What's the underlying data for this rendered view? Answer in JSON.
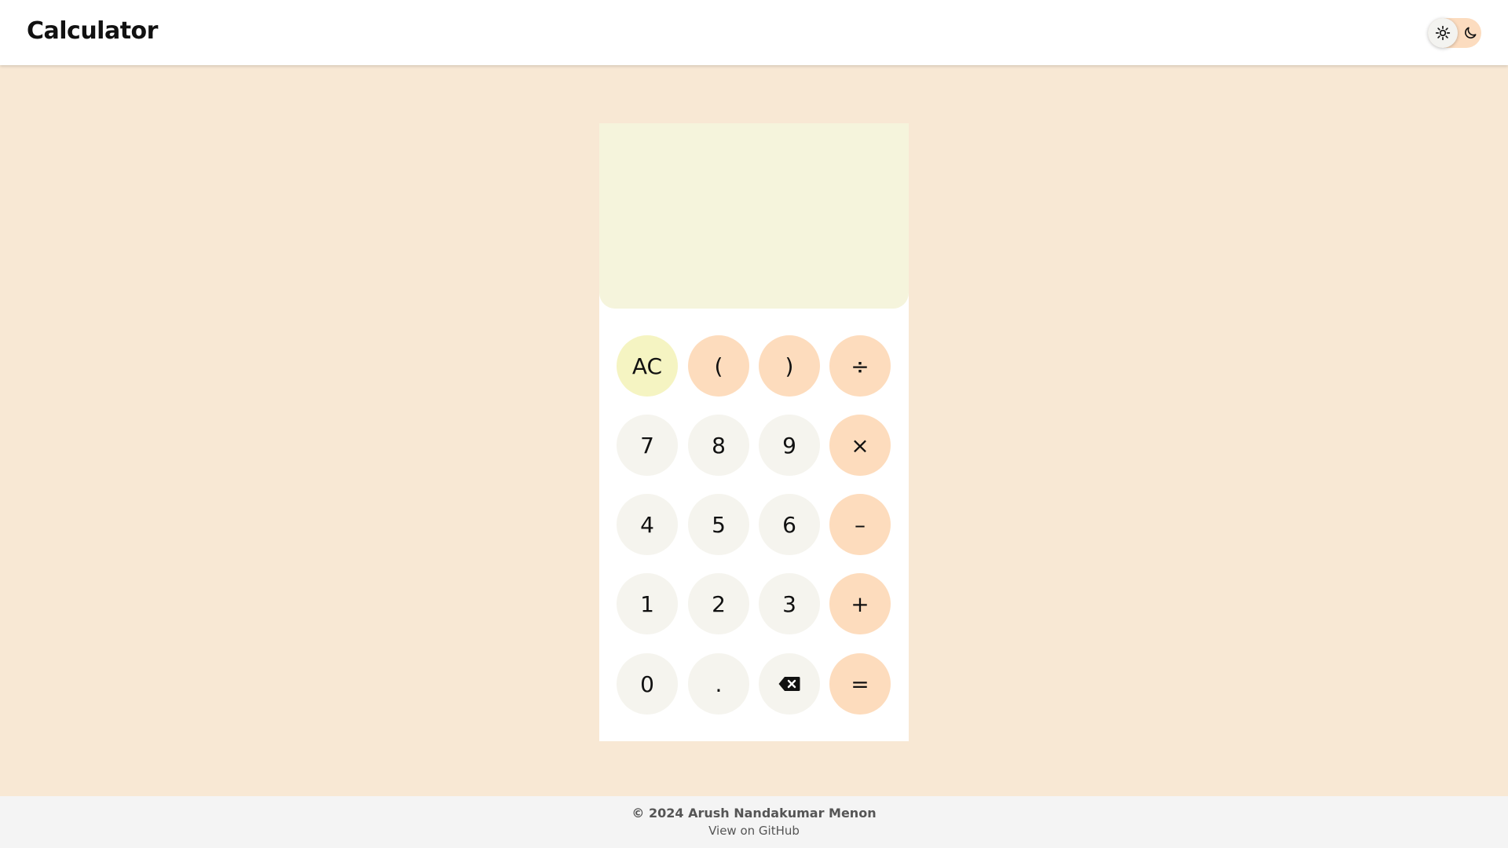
{
  "header": {
    "title": "Calculator",
    "theme_toggle": {
      "light_icon": "sun-icon",
      "dark_icon": "moon-icon",
      "active": "light"
    }
  },
  "display": {
    "value": ""
  },
  "keys": {
    "ac": "AC",
    "open_paren": "(",
    "close_paren": ")",
    "divide": "÷",
    "seven": "7",
    "eight": "8",
    "nine": "9",
    "multiply": "×",
    "four": "4",
    "five": "5",
    "six": "6",
    "minus": "–",
    "one": "1",
    "two": "2",
    "three": "3",
    "plus": "+",
    "zero": "0",
    "decimal": ".",
    "backspace_icon": "backspace-icon",
    "equals": "="
  },
  "footer": {
    "copyright": "© 2024 Arush Nandakumar Menon",
    "github_link": "View on GitHub"
  },
  "colors": {
    "page_background": "#f8e8d4",
    "display_background": "#f5f4dc",
    "number_key": "#f5f4ee",
    "operator_key": "#fddcbd",
    "clear_key": "#f5f4c2"
  }
}
